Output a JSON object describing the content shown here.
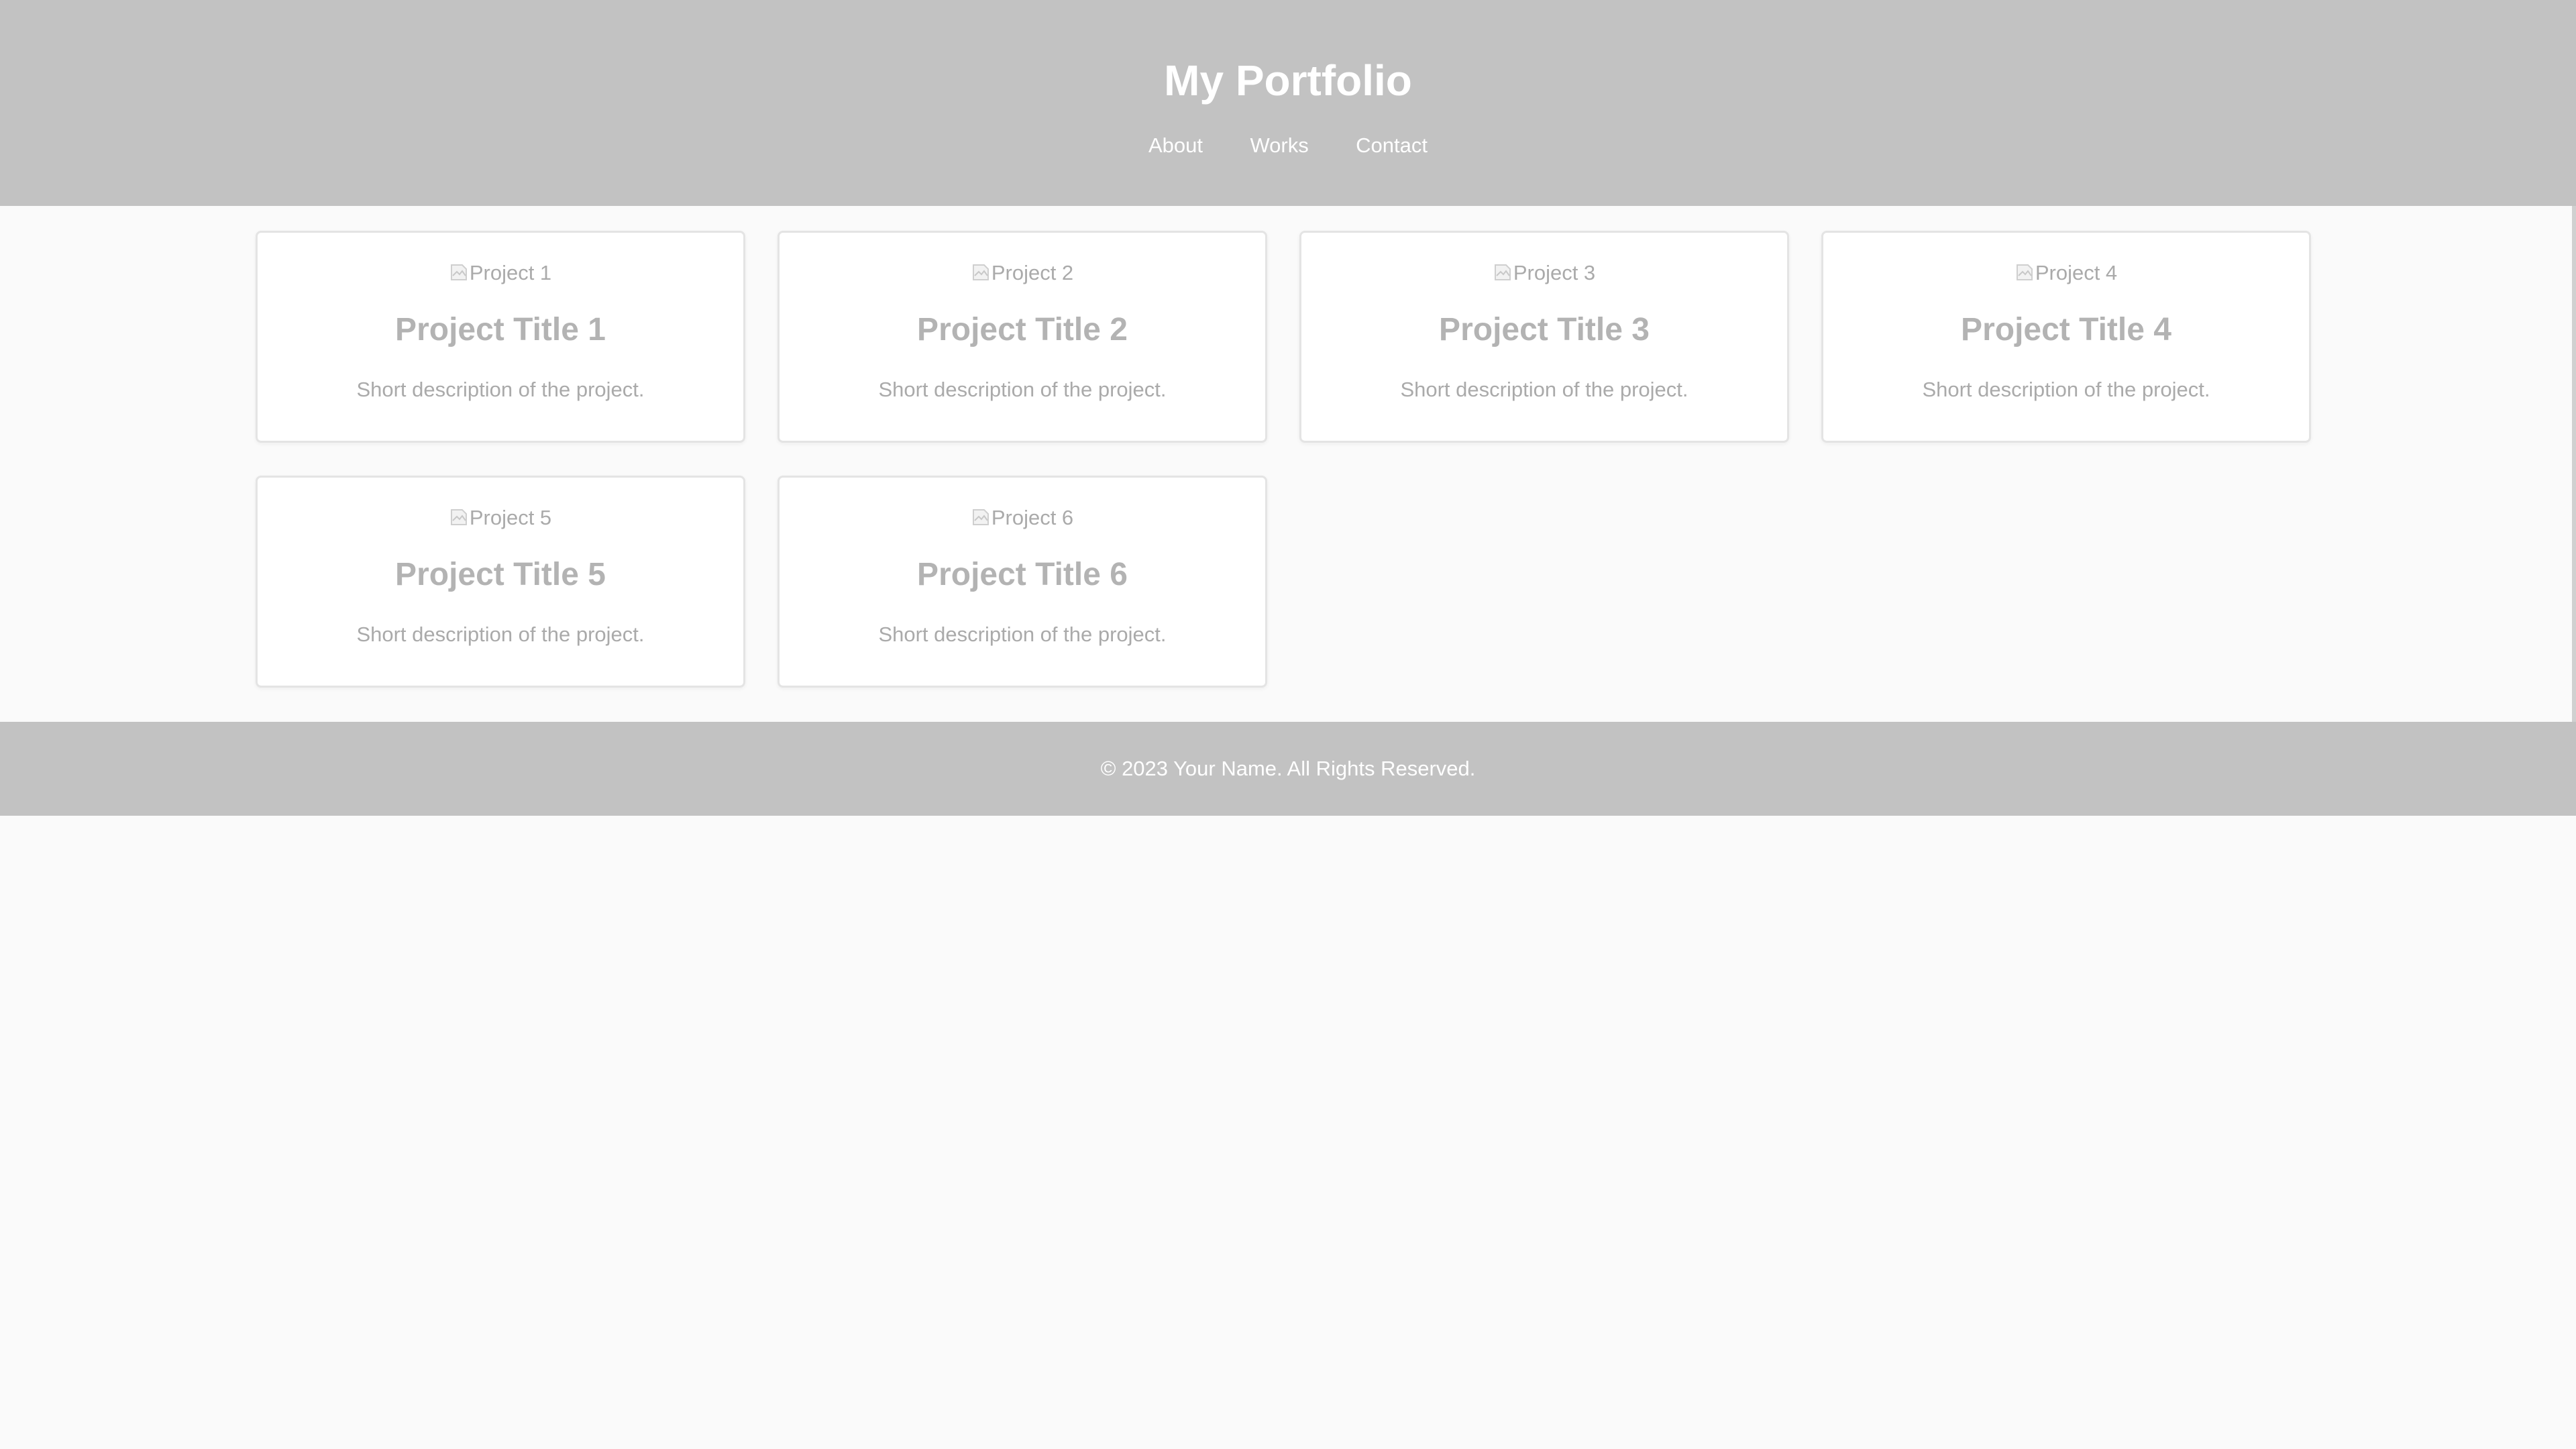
{
  "header": {
    "title": "My Portfolio",
    "nav": [
      "About",
      "Works",
      "Contact"
    ]
  },
  "projects": [
    {
      "image_alt": "Project 1",
      "title": "Project Title 1",
      "description": "Short description of the project."
    },
    {
      "image_alt": "Project 2",
      "title": "Project Title 2",
      "description": "Short description of the project."
    },
    {
      "image_alt": "Project 3",
      "title": "Project Title 3",
      "description": "Short description of the project."
    },
    {
      "image_alt": "Project 4",
      "title": "Project Title 4",
      "description": "Short description of the project."
    },
    {
      "image_alt": "Project 5",
      "title": "Project Title 5",
      "description": "Short description of the project."
    },
    {
      "image_alt": "Project 6",
      "title": "Project Title 6",
      "description": "Short description of the project."
    }
  ],
  "footer": {
    "text": "© 2023 Your Name. All Rights Reserved."
  },
  "colors": {
    "header_bg": "#c2c2c2",
    "page_bg": "#fafafa",
    "card_text": "#aaaaaa"
  }
}
